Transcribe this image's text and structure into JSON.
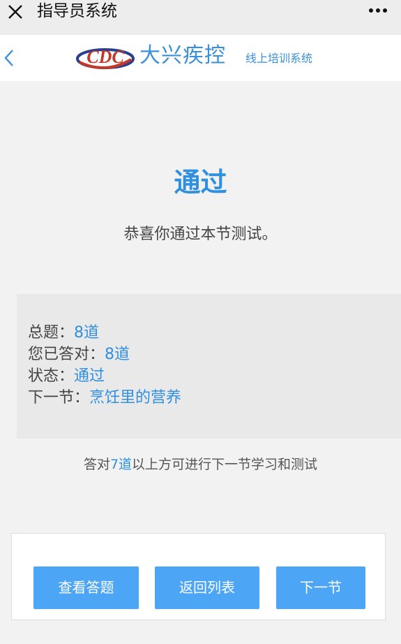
{
  "window": {
    "title": "指导员系统",
    "close_icon": "close-icon",
    "more_icon": "more-icon"
  },
  "header": {
    "brand": "大兴疾控",
    "subtitle": "线上培训系统",
    "logo_text": "CDC",
    "accent_color": "#3a8fd9"
  },
  "result": {
    "title": "通过",
    "message": "恭喜你通过本节测试。"
  },
  "info": {
    "total_label": "总题：",
    "total_value": "8道",
    "correct_label": "您已答对：",
    "correct_value": "8道",
    "status_label": "状态：",
    "status_value": "通过",
    "next_label": "下一节：",
    "next_value": "烹饪里的营养"
  },
  "note": {
    "prefix": "答对",
    "highlight": "7道",
    "suffix": "以上方可进行下一节学习和测试"
  },
  "buttons": {
    "view_answers": "查看答题",
    "back_to_list": "返回列表",
    "next_section": "下一节"
  }
}
